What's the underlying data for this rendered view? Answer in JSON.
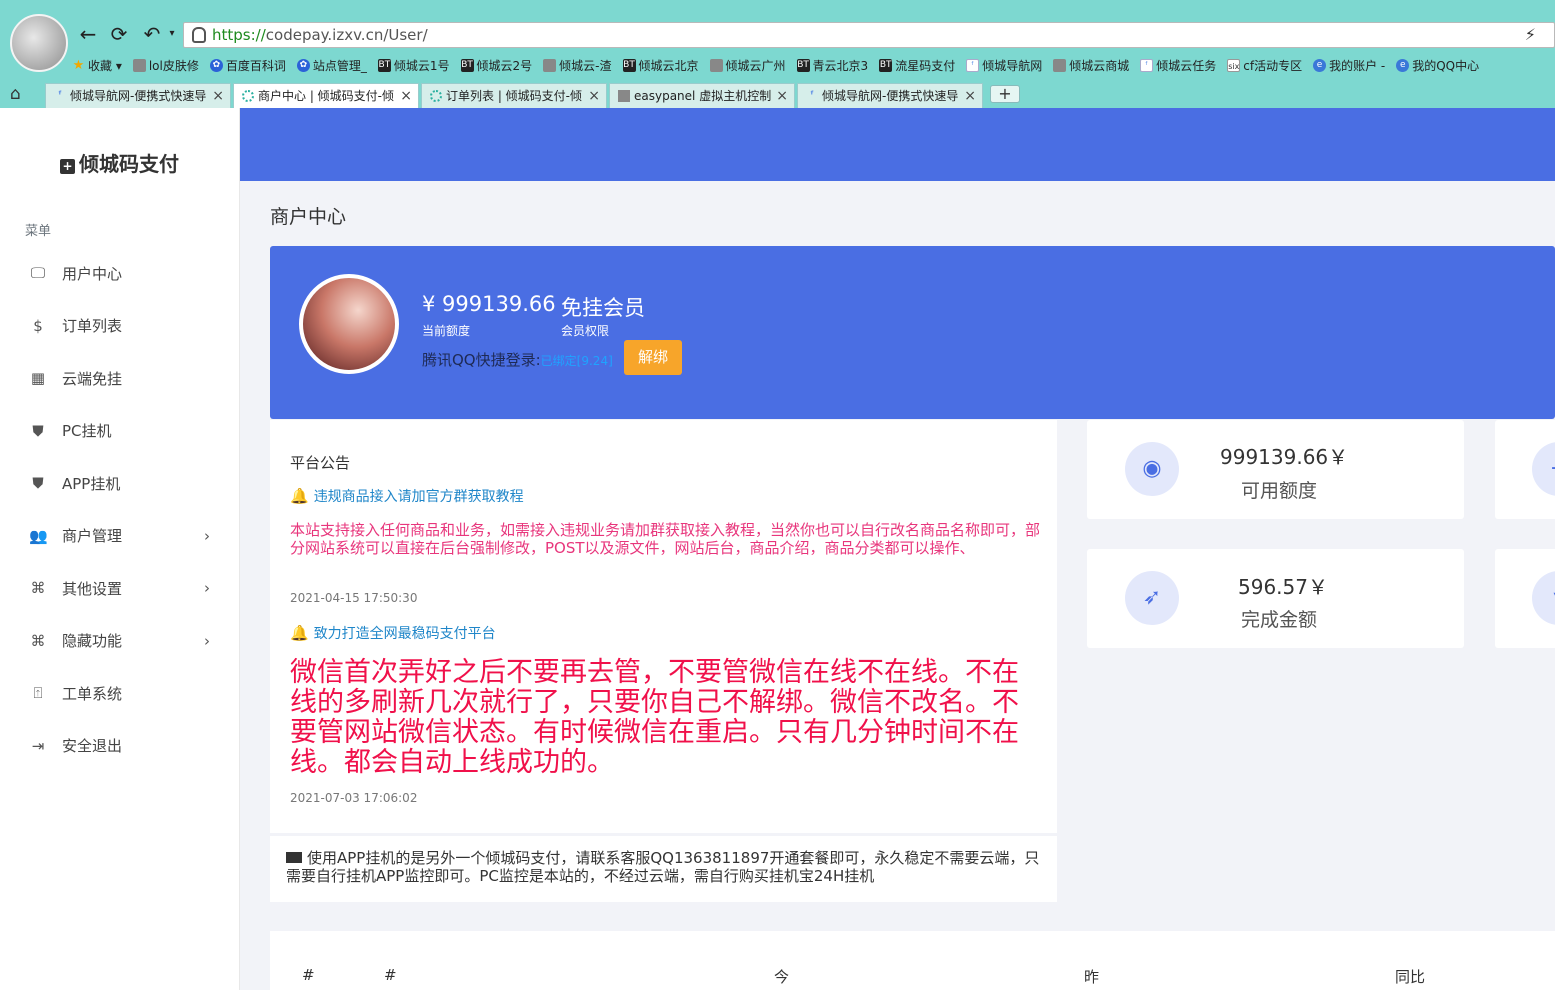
{
  "browser": {
    "url_scheme": "https://",
    "url_rest": "codepay.izxv.cn/User/",
    "bookmarks": [
      {
        "icon": "star",
        "label": "收藏 ▾"
      },
      {
        "icon": "doc",
        "label": "lol皮肤修"
      },
      {
        "icon": "paw",
        "label": "百度百科词"
      },
      {
        "icon": "paw",
        "label": "站点管理_"
      },
      {
        "icon": "bt",
        "label": "倾城云1号"
      },
      {
        "icon": "bt",
        "label": "倾城云2号"
      },
      {
        "icon": "doc",
        "label": "倾城云-渣"
      },
      {
        "icon": "bt",
        "label": "倾城云北京"
      },
      {
        "icon": "doc",
        "label": "倾城云广州"
      },
      {
        "icon": "bt",
        "label": "青云北京3"
      },
      {
        "icon": "bt",
        "label": "流星码支付"
      },
      {
        "icon": "sky",
        "label": "倾城导航网"
      },
      {
        "icon": "doc",
        "label": "倾城云商城"
      },
      {
        "icon": "sky",
        "label": "倾城云任务"
      },
      {
        "icon": "six",
        "label": "cf活动专区"
      },
      {
        "icon": "ie",
        "label": "我的账户 -"
      },
      {
        "icon": "ie",
        "label": "我的QQ中心"
      }
    ],
    "tabs": [
      {
        "label": "倾城导航网-便携式快速导",
        "icon": "sky"
      },
      {
        "label": "商户中心 | 倾城码支付-倾",
        "icon": "loading"
      },
      {
        "label": "订单列表 | 倾城码支付-倾",
        "icon": "loading"
      },
      {
        "label": "easypanel 虚拟主机控制",
        "icon": "doc"
      },
      {
        "label": "倾城导航网-便携式快速导",
        "icon": "sky"
      }
    ],
    "new_tab": "+"
  },
  "sidebar": {
    "brand": "倾城码支付",
    "menu_title": "菜单",
    "items": [
      {
        "icon": "monitor-icon",
        "label": "用户中心",
        "chevron": false
      },
      {
        "icon": "dollar-icon",
        "label": "订单列表",
        "chevron": false
      },
      {
        "icon": "qrcode-icon",
        "label": "云端免挂",
        "chevron": false
      },
      {
        "icon": "shield-icon",
        "label": "PC挂机",
        "chevron": false
      },
      {
        "icon": "shield-icon",
        "label": "APP挂机",
        "chevron": false
      },
      {
        "icon": "users-icon",
        "label": "商户管理",
        "chevron": true
      },
      {
        "icon": "command-icon",
        "label": "其他设置",
        "chevron": true
      },
      {
        "icon": "command-icon",
        "label": "隐藏功能",
        "chevron": true
      },
      {
        "icon": "ticket-icon",
        "label": "工单系统",
        "chevron": false
      },
      {
        "icon": "logout-icon",
        "label": "安全退出",
        "chevron": false
      }
    ]
  },
  "page": {
    "title": "商户中心"
  },
  "profile": {
    "balance": "¥ 999139.66",
    "balance_label": "当前额度",
    "level": "免挂会员",
    "level_label": "会员权限",
    "qq_label": "腾讯QQ快捷登录:",
    "qq_status": "已绑定[9.24]",
    "unbind": "解绑"
  },
  "notice": {
    "title": "平台公告",
    "items": [
      {
        "head": "违规商品接入请加官方群获取教程",
        "body": "本站支持接入任何商品和业务，如需接入违规业务请加群获取接入教程，当然你也可以自行改名商品名称即可，部分网站系统可以直接在后台强制修改，POST以及源文件，网站后台，商品介绍，商品分类都可以操作、",
        "date": "2021-04-15 17:50:30"
      },
      {
        "head": "致力打造全网最稳码支付平台",
        "body": "微信首次弄好之后不要再去管，不要管微信在线不在线。不在线的多刷新几次就行了，只要你自己不解绑。微信不改名。不要管网站微信状态。有时候微信在重启。只有几分钟时间不在线。都会自动上线成功的。",
        "date": "2021-07-03 17:06:02"
      }
    ]
  },
  "app_notice": {
    "text": "使用APP挂机的是另外一个倾城码支付，请联系客服QQ1363811897开通套餐即可，永久稳定不需要云端，只需要自行挂机APP监控即可。PC监控是本站的，不经过云端，需自行购买挂机宝24H挂机"
  },
  "stats": [
    {
      "value": "999139.66￥",
      "label": "可用额度",
      "icon": "camera-icon"
    },
    {
      "value": "596.57￥",
      "label": "完成金额",
      "icon": "rocket-icon"
    }
  ],
  "table": {
    "headers": [
      "#",
      "#",
      "今",
      "昨",
      "同比"
    ]
  },
  "colors": {
    "chrome": "#7dd8d0",
    "primary": "#4a6ee3",
    "unbind": "#f7a52a",
    "notice_link": "#1f86c9",
    "notice_pink": "#e8367c",
    "notice_red": "#f0104a"
  }
}
